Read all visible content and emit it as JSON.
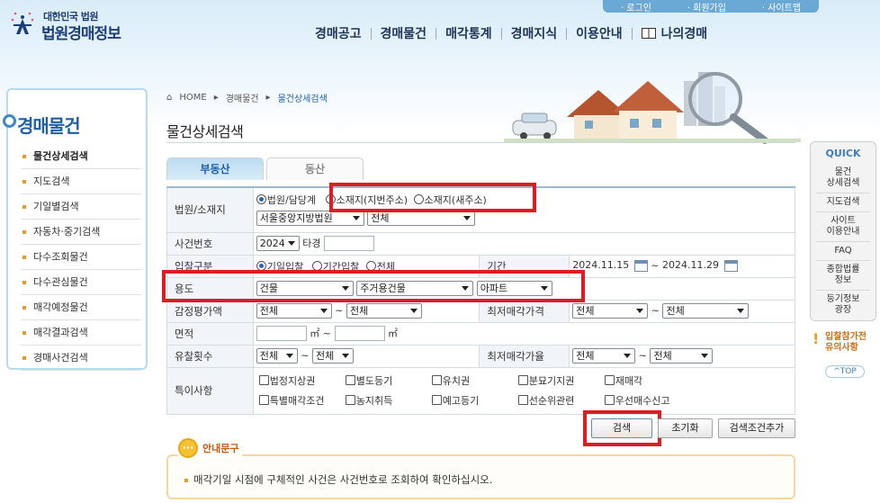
{
  "logo": {
    "small": "대한민국 법원",
    "big": "법원경매정보"
  },
  "top_links": [
    "· 로그인",
    "· 회원가입",
    "· 사이트맵"
  ],
  "gnb": [
    "경매공고",
    "경매물건",
    "매각통계",
    "경매지식",
    "이용안내",
    "나의경매"
  ],
  "sidebar": {
    "title": "경매물건",
    "items": [
      "물건상세검색",
      "지도검색",
      "기일별검색",
      "자동차·중기검색",
      "다수조회물건",
      "다수관심물건",
      "매각예정물건",
      "매각결과검색",
      "경매사건검색"
    ]
  },
  "breadcrumb": {
    "home": "HOME",
    "section": "경매물건",
    "current": "물건상세검색"
  },
  "page_title": "물건상세검색",
  "tabs": [
    "부동산",
    "동산"
  ],
  "form": {
    "court_label": "법원/소재지",
    "court_radio_1": "법원/담당계",
    "court_radio_2": "소재지(지번주소)",
    "court_radio_3": "소재지(새주소)",
    "court_select": "서울중앙지방법원",
    "court_sub_select": "전체",
    "case_label": "사건번호",
    "case_year": "2024",
    "case_text": "타경",
    "bid_label": "입찰구분",
    "bid_radio_1": "기일입찰",
    "bid_radio_2": "기간입찰",
    "bid_radio_3": "전체",
    "period_label": "기간",
    "date_from": "2024.11.15",
    "date_to": "2024.11.29",
    "usage_label": "용도",
    "usage_1": "건물",
    "usage_2": "주거용건물",
    "usage_3": "아파트",
    "appraisal_label": "감정평가액",
    "appraisal_from": "전체",
    "appraisal_to": "전체",
    "minprice_label": "최저매각가격",
    "minprice_from": "전체",
    "minprice_to": "전체",
    "area_label": "면적",
    "area_unit": "㎡",
    "fail_label": "유찰횟수",
    "fail_from": "전체",
    "fail_to": "전체",
    "minrate_label": "최저매각가율",
    "minrate_from": "전체",
    "minrate_to": "전체",
    "special_label": "특이사항",
    "special_items": [
      "법정지상권",
      "별도등기",
      "유치권",
      "분묘기지권",
      "재매각",
      "특별매각조건",
      "농지취득",
      "예고등기",
      "선순위관련",
      "우선매수신고"
    ],
    "tilde": "~"
  },
  "buttons": {
    "search": "검색",
    "reset": "초기화",
    "add_condition": "검색조건추가"
  },
  "notice": {
    "title": "안내문구",
    "text": "매각기일 시점에 구체적인 사건은 사건번호로 조회하여 확인하십시오."
  },
  "quick": {
    "title": "QUICK",
    "items": [
      "물건\n상세검색",
      "지도검색",
      "사이트\n이용안내",
      "FAQ",
      "종합법률\n정보",
      "등기정보\n광장"
    ],
    "warn_1": "입찰참가전",
    "warn_2": "유의사항",
    "top": "^TOP"
  },
  "colors": {
    "brand": "#1c3f7a",
    "accent": "#1a5fa8",
    "highlight": "#e01b24"
  }
}
